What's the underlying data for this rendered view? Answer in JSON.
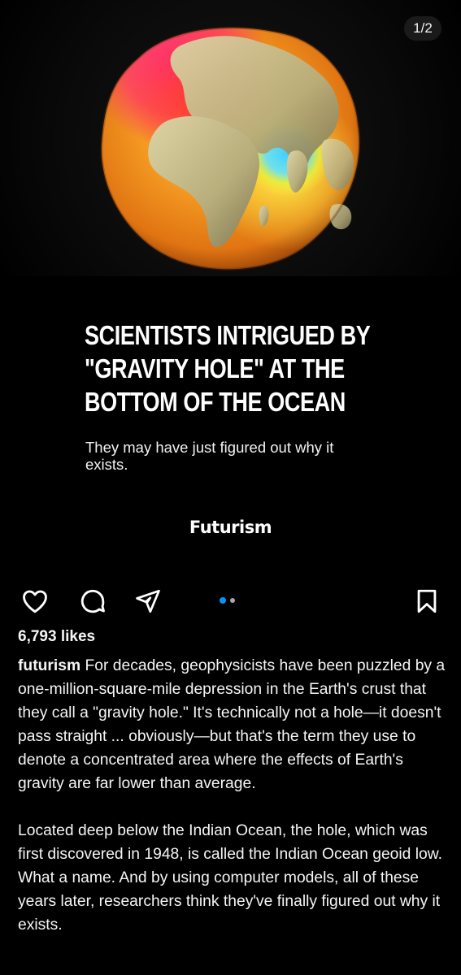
{
  "post": {
    "page_counter": "1/2",
    "headline": "SCIENTISTS INTRIGUED BY \"GRAVITY HOLE\" AT THE BOTTOM OF THE OCEAN",
    "subhead": "They may have just figured out why it exists.",
    "brand": "Futurism",
    "image_description_icon": "geoid-globe-image"
  },
  "actions": {
    "like_icon": "heart-icon",
    "comment_icon": "comment-icon",
    "share_icon": "share-icon",
    "save_icon": "bookmark-icon",
    "carousel_index": 1,
    "carousel_total": 2,
    "active_dot_color": "#0095f6"
  },
  "likes": "6,793 likes",
  "caption": {
    "username": "futurism",
    "paragraph1": "For decades, geophysicists have been puzzled by a one-million-square-mile depression in the Earth's crust that they call a \"gravity hole.\" It's technically not a hole—it doesn't pass straight ... obviously—but that's the term they use to denote a concentrated area where the effects of Earth's gravity are far lower than average.",
    "paragraph2": "Located deep below the Indian Ocean, the hole, which was first discovered in 1948, is called the Indian Ocean geoid low. What a name. And by using computer models, all of these years later, researchers think they've finally figured out why it exists."
  }
}
